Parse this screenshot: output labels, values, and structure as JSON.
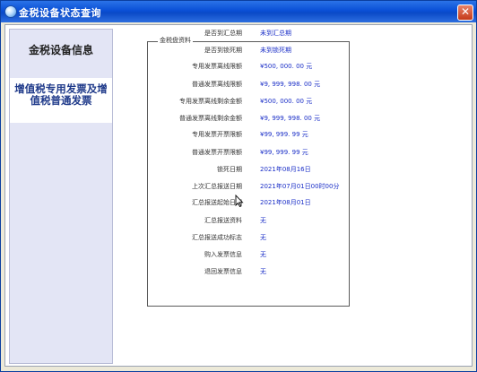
{
  "window": {
    "title": "金税设备状态查询",
    "close_symbol": "✕"
  },
  "sidebar": {
    "items": [
      {
        "label": "金税设备信息"
      },
      {
        "label_line1": "增值税专用发票及增",
        "label_line2": "值税普通发票"
      }
    ]
  },
  "group": {
    "title": "金税盘资料"
  },
  "fields": [
    {
      "label": "是否到汇总期",
      "value": "未到汇总期"
    },
    {
      "label": "是否到锁死期",
      "value": "未到锁死期"
    },
    {
      "label": "专用发票离线限额",
      "value": "¥500, 000. 00 元"
    },
    {
      "label": "普通发票离线限额",
      "value": "¥9, 999, 998. 00 元"
    },
    {
      "label": "专用发票离线剩余金额",
      "value": "¥500, 000. 00 元"
    },
    {
      "label": "普通发票离线剩余金额",
      "value": "¥9, 999, 998. 00 元"
    },
    {
      "label": "专用发票开票限额",
      "value": "¥99, 999. 99 元"
    },
    {
      "label": "普通发票开票限额",
      "value": "¥99, 999. 99 元"
    },
    {
      "label": "锁死日期",
      "value": "2021年08月16日"
    },
    {
      "label": "上次汇总报送日期",
      "value": "2021年07月01日00时00分"
    },
    {
      "label": "汇总报送起始日期",
      "value": "2021年08月01日"
    },
    {
      "label": "汇总报送资料",
      "value": "无"
    },
    {
      "label": "汇总报送成功标志",
      "value": "无"
    },
    {
      "label": "购入发票信息",
      "value": "无"
    },
    {
      "label": "退回发票信息",
      "value": "无"
    }
  ]
}
